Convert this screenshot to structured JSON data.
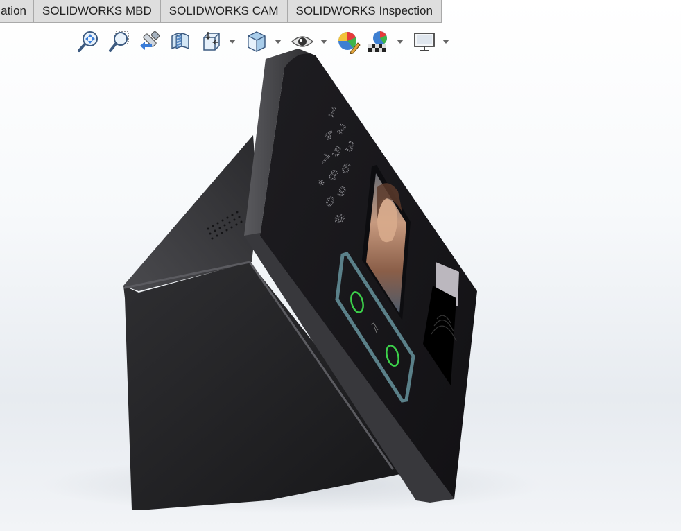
{
  "tabs": [
    {
      "label": "ation"
    },
    {
      "label": "SOLIDWORKS MBD"
    },
    {
      "label": "SOLIDWORKS CAM"
    },
    {
      "label": "SOLIDWORKS Inspection"
    }
  ],
  "toolbar": {
    "icons": [
      "zoom-to-fit-icon",
      "zoom-to-area-icon",
      "previous-view-icon",
      "section-view-icon",
      "view-orientation-icon",
      "display-style-icon",
      "hide-show-items-icon",
      "edit-appearance-icon",
      "apply-scene-icon",
      "view-settings-icon"
    ]
  },
  "model": {
    "keypad_digits": [
      "1",
      "2",
      "3",
      "4",
      "5",
      "6",
      "7",
      "8",
      "9",
      "*",
      "0",
      "#"
    ],
    "colors": {
      "body": "#2a2a2d",
      "front_panel": "#1d1c20",
      "accent_frame": "#5a8089",
      "sensor_ring": "#3cd04a"
    }
  }
}
